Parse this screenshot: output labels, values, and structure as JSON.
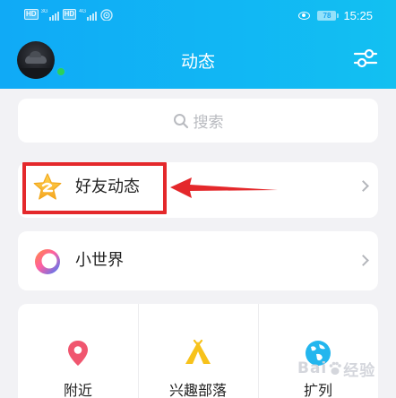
{
  "statusbar": {
    "left_badges": [
      "HD",
      "HD"
    ],
    "signal_labels": [
      "3G",
      "4G"
    ],
    "battery": "78",
    "time": "15:25"
  },
  "header": {
    "title": "动态",
    "settings_icon": "sliders-icon",
    "online_color": "#2bd15a"
  },
  "search": {
    "placeholder": "搜索",
    "icon": "search-icon"
  },
  "rows": {
    "friends": {
      "label": "好友动态",
      "icon": "star-icon"
    },
    "world": {
      "label": "小世界",
      "icon": "ring-icon"
    }
  },
  "annotation": {
    "color": "#e4282b"
  },
  "grid": [
    {
      "label": "附近",
      "icon": "location-pin-icon"
    },
    {
      "label": "兴趣部落",
      "icon": "tent-icon"
    },
    {
      "label": "扩列",
      "icon": "globe-icon"
    }
  ],
  "watermark": {
    "text": "Bai",
    "text2": "经验"
  }
}
